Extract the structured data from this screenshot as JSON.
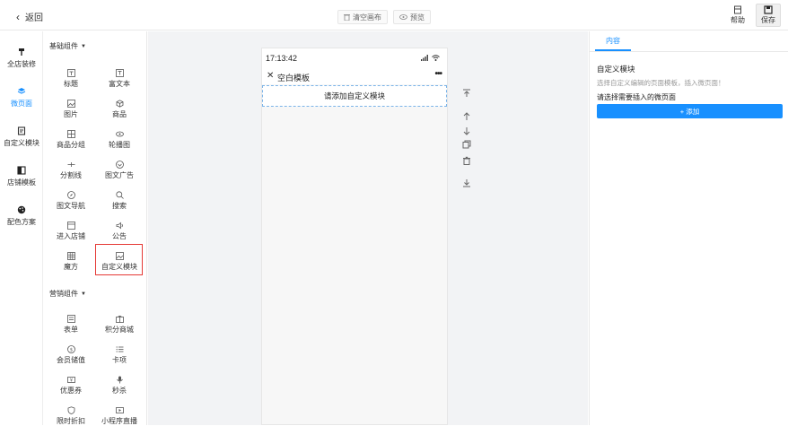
{
  "topbar": {
    "back_label": "返回",
    "clear_label": "清空画布",
    "preview_label": "预览",
    "help_label": "帮助",
    "save_label": "保存"
  },
  "leftnav": {
    "items": [
      {
        "label": "全店装修",
        "icon": "brush-icon"
      },
      {
        "label": "微页面",
        "icon": "layers-icon",
        "active": true
      },
      {
        "label": "自定义模块",
        "icon": "module-icon"
      },
      {
        "label": "店铺模板",
        "icon": "template-icon"
      },
      {
        "label": "配色方案",
        "icon": "palette-icon"
      }
    ]
  },
  "components": {
    "basic_title": "基础组件",
    "basic": [
      "标题",
      "富文本",
      "图片",
      "商品",
      "商品分组",
      "轮播图",
      "分割线",
      "图文广告",
      "图文导航",
      "搜索",
      "进入店铺",
      "公告",
      "魔方",
      "自定义模块"
    ],
    "marketing_title": "营销组件",
    "marketing": [
      "表单",
      "积分商城",
      "会员储值",
      "卡项",
      "优惠券",
      "秒杀",
      "限时折扣",
      "小程序直播"
    ]
  },
  "phone": {
    "time": "17:13:42",
    "page_title": "空白模板",
    "add_module_text": "请添加自定义模块"
  },
  "rpanel": {
    "tab_label": "内容",
    "title": "自定义模块",
    "description": "选择自定义编辑的页面模板，插入微页面！",
    "select_label": "请选择需要插入的微页面",
    "add_button": "+ 添加"
  },
  "colors": {
    "accent": "#1890ff",
    "highlight": "#e53935",
    "canvas_bg": "#f2f3f5"
  }
}
